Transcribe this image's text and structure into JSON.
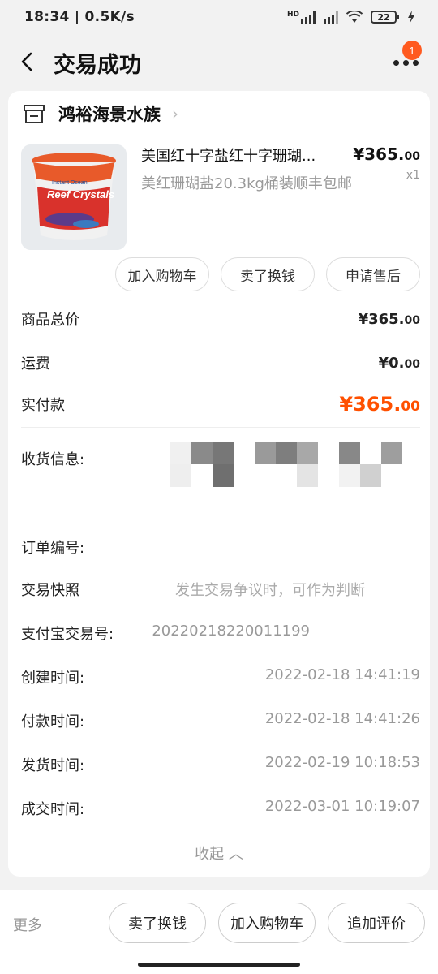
{
  "status_bar": {
    "time_speed": "18:34 | 0.5K/s",
    "network_label": "HD",
    "battery": "22"
  },
  "header": {
    "title": "交易成功",
    "badge_count": "1"
  },
  "shop": {
    "name": "鸿裕海景水族"
  },
  "product": {
    "title": "美国红十字盐红十字珊瑚...",
    "spec": "美红珊瑚盐20.3kg桶装顺丰包邮",
    "price_main": "¥365.",
    "price_cents": "00",
    "quantity": "x1",
    "image_brand": "Instant Ocean",
    "image_label": "Reef Crystals"
  },
  "product_actions": [
    "加入购物车",
    "卖了换钱",
    "申请售后"
  ],
  "summary": {
    "goods_total_label": "商品总价",
    "goods_total_main": "¥365.",
    "goods_total_cents": "00",
    "shipping_label": "运费",
    "shipping_main": "¥0.",
    "shipping_cents": "00",
    "paid_label": "实付款",
    "paid_main": "¥365.",
    "paid_cents": "00"
  },
  "order_info": {
    "address_label": "收货信息:",
    "order_no_label": "订单编号:",
    "snapshot_label": "交易快照",
    "snapshot_value": "发生交易争议时，可作为判断",
    "alipay_label": "支付宝交易号:",
    "alipay_value": "20220218220011199",
    "created_label": "创建时间:",
    "created_value": "2022-02-18 14:41:19",
    "paid_time_label": "付款时间:",
    "paid_time_value": "2022-02-18 14:41:26",
    "shipped_label": "发货时间:",
    "shipped_value": "2022-02-19 10:18:53",
    "completed_label": "成交时间:",
    "completed_value": "2022-03-01 10:19:07",
    "collapse_label": "收起 ︿"
  },
  "bottom_bar": {
    "more_label": "更多",
    "sell_label": "卖了换钱",
    "cart_label": "加入购物车",
    "review_label": "追加评价"
  },
  "colors": {
    "accent": "#ff5000",
    "badge": "#ff5a1f"
  }
}
